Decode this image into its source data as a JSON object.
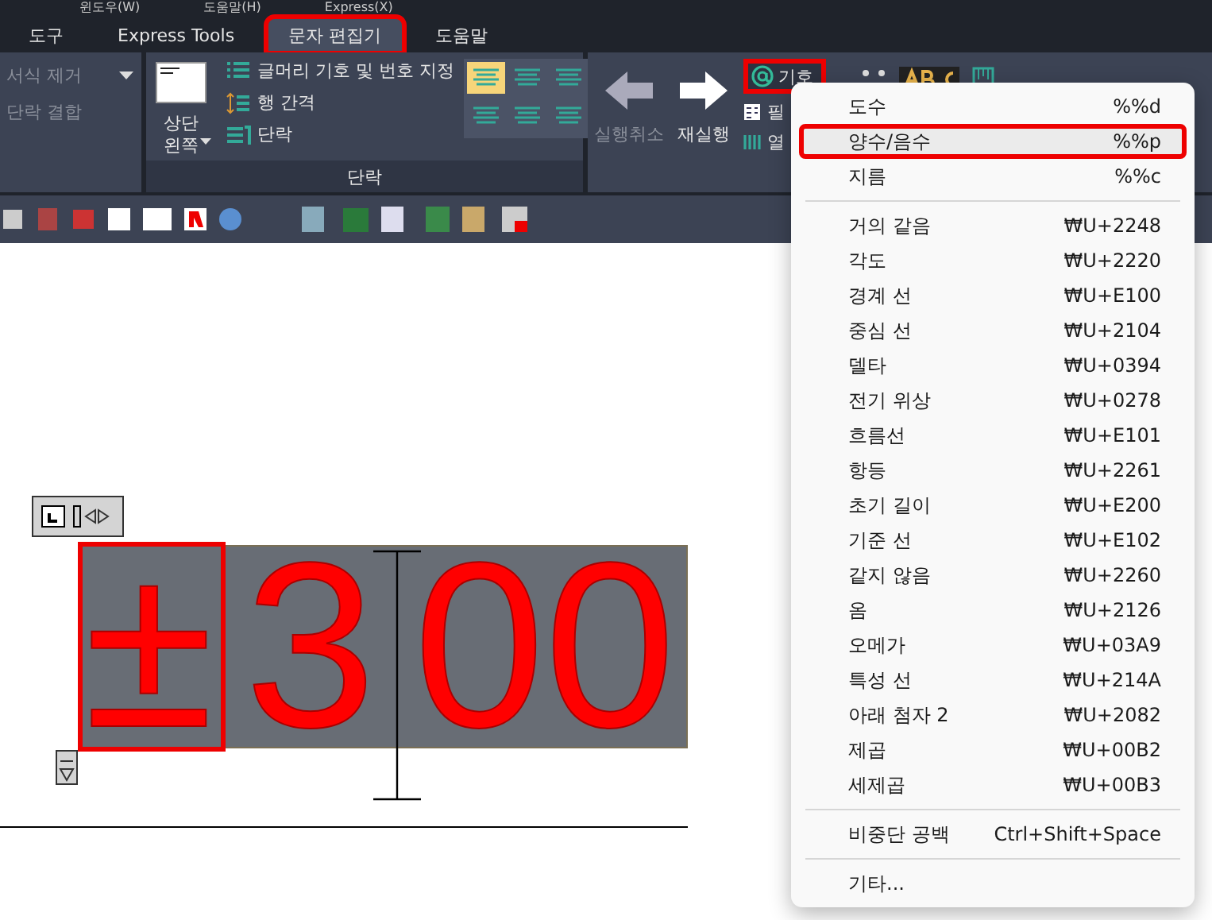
{
  "menubar": [
    "윈도우(W)",
    "도움말(H)",
    "Express(X)"
  ],
  "tabs": [
    {
      "label": "도구",
      "selected": false,
      "annotated": false
    },
    {
      "label": "Express Tools",
      "selected": false,
      "annotated": false
    },
    {
      "label": "문자 편집기",
      "selected": true,
      "annotated": true
    },
    {
      "label": "도움말",
      "selected": false,
      "annotated": false
    }
  ],
  "ribbon": {
    "format_panel": {
      "items": [
        {
          "label": "서식 제거",
          "disabled": true,
          "dropdown": true
        },
        {
          "label": "단락 결합",
          "disabled": true,
          "dropdown": false
        }
      ]
    },
    "paragraph_panel": {
      "title": "단락",
      "justify_button": {
        "line1": "상단",
        "line2": "왼쪽"
      },
      "items": [
        {
          "label": "글머리 기호 및 번호 지정",
          "kind": "bullets"
        },
        {
          "label": "행 간격",
          "kind": "spacing"
        },
        {
          "label": "단락",
          "kind": "paragraph"
        }
      ],
      "alignments": [
        {
          "selected": true
        },
        {
          "selected": false
        },
        {
          "selected": false
        },
        {
          "selected": false
        },
        {
          "selected": false
        },
        {
          "selected": false
        }
      ]
    },
    "tools_panel": {
      "undo": {
        "label": "실행취소",
        "disabled": true
      },
      "redo": {
        "label": "재실행",
        "disabled": false
      },
      "symbol": {
        "label": "기호",
        "annotated": true
      },
      "field": {
        "label": "필"
      },
      "columns": {
        "label": "열"
      }
    }
  },
  "editor": {
    "text_parts": [
      {
        "text": "±",
        "annotated": true
      },
      {
        "text": "3",
        "annotated": false
      },
      {
        "text": "00",
        "annotated": false
      }
    ]
  },
  "symbol_menu": {
    "groups": [
      [
        {
          "label": "도수",
          "shortcut": "%%d",
          "selected": false,
          "annotated": false
        },
        {
          "label": "양수/음수",
          "shortcut": "%%p",
          "selected": true,
          "annotated": true
        },
        {
          "label": "지름",
          "shortcut": "%%c",
          "selected": false,
          "annotated": false
        }
      ],
      [
        {
          "label": "거의 같음",
          "shortcut": "₩U+2248",
          "selected": false,
          "annotated": false
        },
        {
          "label": "각도",
          "shortcut": "₩U+2220",
          "selected": false,
          "annotated": false
        },
        {
          "label": "경계 선",
          "shortcut": "₩U+E100",
          "selected": false,
          "annotated": false
        },
        {
          "label": "중심 선",
          "shortcut": "₩U+2104",
          "selected": false,
          "annotated": false
        },
        {
          "label": "델타",
          "shortcut": "₩U+0394",
          "selected": false,
          "annotated": false
        },
        {
          "label": "전기 위상",
          "shortcut": "₩U+0278",
          "selected": false,
          "annotated": false
        },
        {
          "label": "흐름선",
          "shortcut": "₩U+E101",
          "selected": false,
          "annotated": false
        },
        {
          "label": "항등",
          "shortcut": "₩U+2261",
          "selected": false,
          "annotated": false
        },
        {
          "label": "초기 길이",
          "shortcut": "₩U+E200",
          "selected": false,
          "annotated": false
        },
        {
          "label": "기준 선",
          "shortcut": "₩U+E102",
          "selected": false,
          "annotated": false
        },
        {
          "label": "같지 않음",
          "shortcut": "₩U+2260",
          "selected": false,
          "annotated": false
        },
        {
          "label": "옴",
          "shortcut": "₩U+2126",
          "selected": false,
          "annotated": false
        },
        {
          "label": "오메가",
          "shortcut": "₩U+03A9",
          "selected": false,
          "annotated": false
        },
        {
          "label": "특성 선",
          "shortcut": "₩U+214A",
          "selected": false,
          "annotated": false
        },
        {
          "label": "아래 첨자 2",
          "shortcut": "₩U+2082",
          "selected": false,
          "annotated": false
        },
        {
          "label": "제곱",
          "shortcut": "₩U+00B2",
          "selected": false,
          "annotated": false
        },
        {
          "label": "세제곱",
          "shortcut": "₩U+00B3",
          "selected": false,
          "annotated": false
        }
      ],
      [
        {
          "label": "비중단 공백",
          "shortcut": "Ctrl+Shift+Space",
          "selected": false,
          "annotated": false
        }
      ],
      [
        {
          "label": "기타...",
          "selected": false,
          "annotated": false
        }
      ]
    ]
  }
}
